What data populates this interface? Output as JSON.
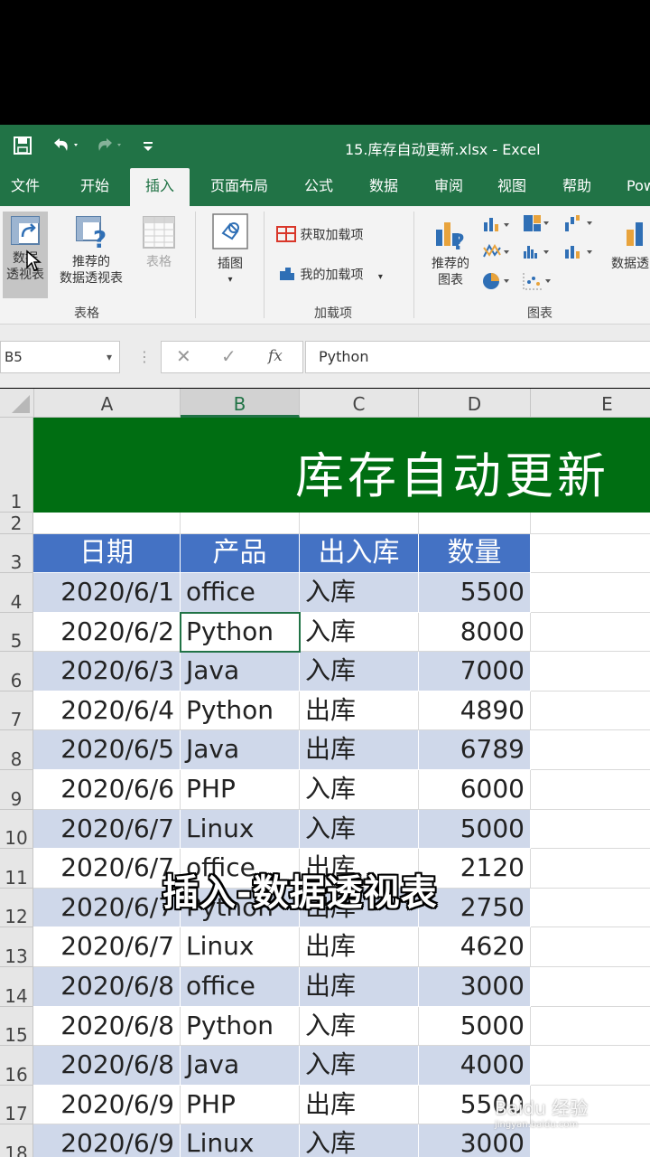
{
  "window": {
    "title": "15.库存自动更新.xlsx  -  Excel"
  },
  "tabs": [
    "文件",
    "开始",
    "插入",
    "页面布局",
    "公式",
    "数据",
    "审阅",
    "视图",
    "帮助",
    "Pow"
  ],
  "active_tab": "插入",
  "ribbon": {
    "pivot_table": "数据\n透视表",
    "pivot_table_l1": "数据",
    "pivot_table_l2": "透视表",
    "recommended_pivot_l1": "推荐的",
    "recommended_pivot_l2": "数据透视表",
    "table": "表格",
    "illustrations": "插图",
    "get_addins": "获取加载项",
    "my_addins": "我的加载项",
    "recommended_charts_l1": "推荐的",
    "recommended_charts_l2": "图表",
    "pivot_chart": "数据透",
    "group_tables": "表格",
    "group_addins": "加载项",
    "group_charts": "图表"
  },
  "formula_bar": {
    "name_box": "B5",
    "content": "Python"
  },
  "columns": [
    "A",
    "B",
    "C",
    "D",
    "E"
  ],
  "sheet": {
    "banner_title": "库存自动更新",
    "headers": [
      "日期",
      "产品",
      "出入库",
      "数量"
    ],
    "rows": [
      {
        "row": "4",
        "date": "2020/6/1",
        "product": "office",
        "io": "入库",
        "qty": "5500"
      },
      {
        "row": "5",
        "date": "2020/6/2",
        "product": "Python",
        "io": "入库",
        "qty": "8000"
      },
      {
        "row": "6",
        "date": "2020/6/3",
        "product": "Java",
        "io": "入库",
        "qty": "7000"
      },
      {
        "row": "7",
        "date": "2020/6/4",
        "product": "Python",
        "io": "出库",
        "qty": "4890"
      },
      {
        "row": "8",
        "date": "2020/6/5",
        "product": "Java",
        "io": "出库",
        "qty": "6789"
      },
      {
        "row": "9",
        "date": "2020/6/6",
        "product": "PHP",
        "io": "入库",
        "qty": "6000"
      },
      {
        "row": "10",
        "date": "2020/6/7",
        "product": "Linux",
        "io": "入库",
        "qty": "5000"
      },
      {
        "row": "11",
        "date": "2020/6/7",
        "product": "office",
        "io": "出库",
        "qty": "2120"
      },
      {
        "row": "12",
        "date": "2020/6/7",
        "product": "Python",
        "io": "出库",
        "qty": "2750"
      },
      {
        "row": "13",
        "date": "2020/6/7",
        "product": "Linux",
        "io": "出库",
        "qty": "4620"
      },
      {
        "row": "14",
        "date": "2020/6/8",
        "product": "office",
        "io": "出库",
        "qty": "3000"
      },
      {
        "row": "15",
        "date": "2020/6/8",
        "product": "Python",
        "io": "入库",
        "qty": "5000"
      },
      {
        "row": "16",
        "date": "2020/6/8",
        "product": "Java",
        "io": "入库",
        "qty": "4000"
      },
      {
        "row": "17",
        "date": "2020/6/9",
        "product": "PHP",
        "io": "出库",
        "qty": "5500"
      },
      {
        "row": "18",
        "date": "2020/6/9",
        "product": "Linux",
        "io": "入库",
        "qty": "3000"
      }
    ]
  },
  "caption": "插入-数据透视表",
  "watermark": {
    "brand": "Baidu 经验",
    "url": "jingyan.baidu.com"
  },
  "colors": {
    "excel_green": "#217346",
    "banner_green": "#006e12",
    "header_blue": "#4472c4",
    "band_blue": "#cfd8ea"
  }
}
